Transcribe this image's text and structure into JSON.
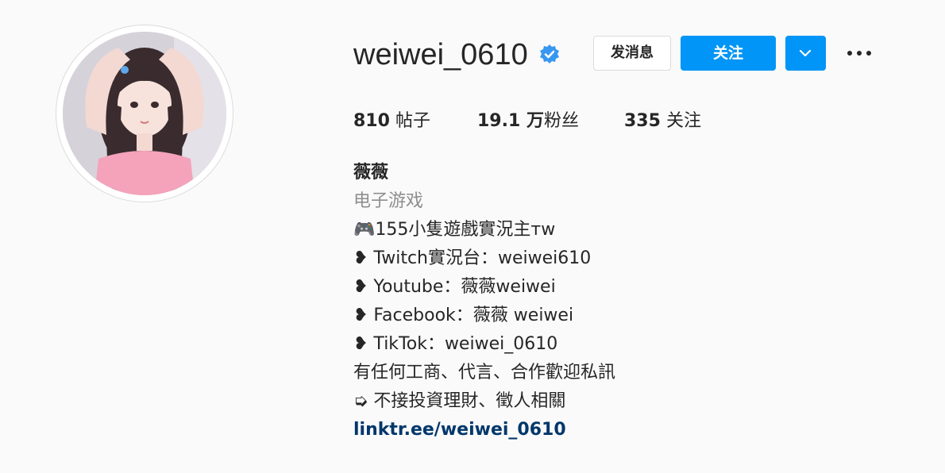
{
  "profile": {
    "username": "weiwei_0610",
    "verified_icon": "verified-badge-icon",
    "accent_color": "#0095f6"
  },
  "actions": {
    "message_label": "发消息",
    "follow_label": "关注",
    "dropdown_icon": "chevron-down-icon",
    "more_icon": "more-options-icon"
  },
  "stats": {
    "posts_count": "810",
    "posts_label": "帖子",
    "followers_count": "19.1 万",
    "followers_label": "粉丝",
    "following_count": "335",
    "following_label": "关注"
  },
  "bio": {
    "display_name": "薇薇",
    "category": "电子游戏",
    "lines": [
      "🎮155小隻遊戲實況主ᴛᴡ",
      "❥ Twitch實況台：weiwei610",
      "❥ Youtube：薇薇weiwei",
      "❥ Facebook：薇薇 weiwei",
      "❥ TikTok：weiwei_0610",
      "有任何工商、代言、合作歡迎私訊",
      "➭ 不接投資理財、徵人相關"
    ],
    "link": "linktr.ee/weiwei_0610"
  }
}
